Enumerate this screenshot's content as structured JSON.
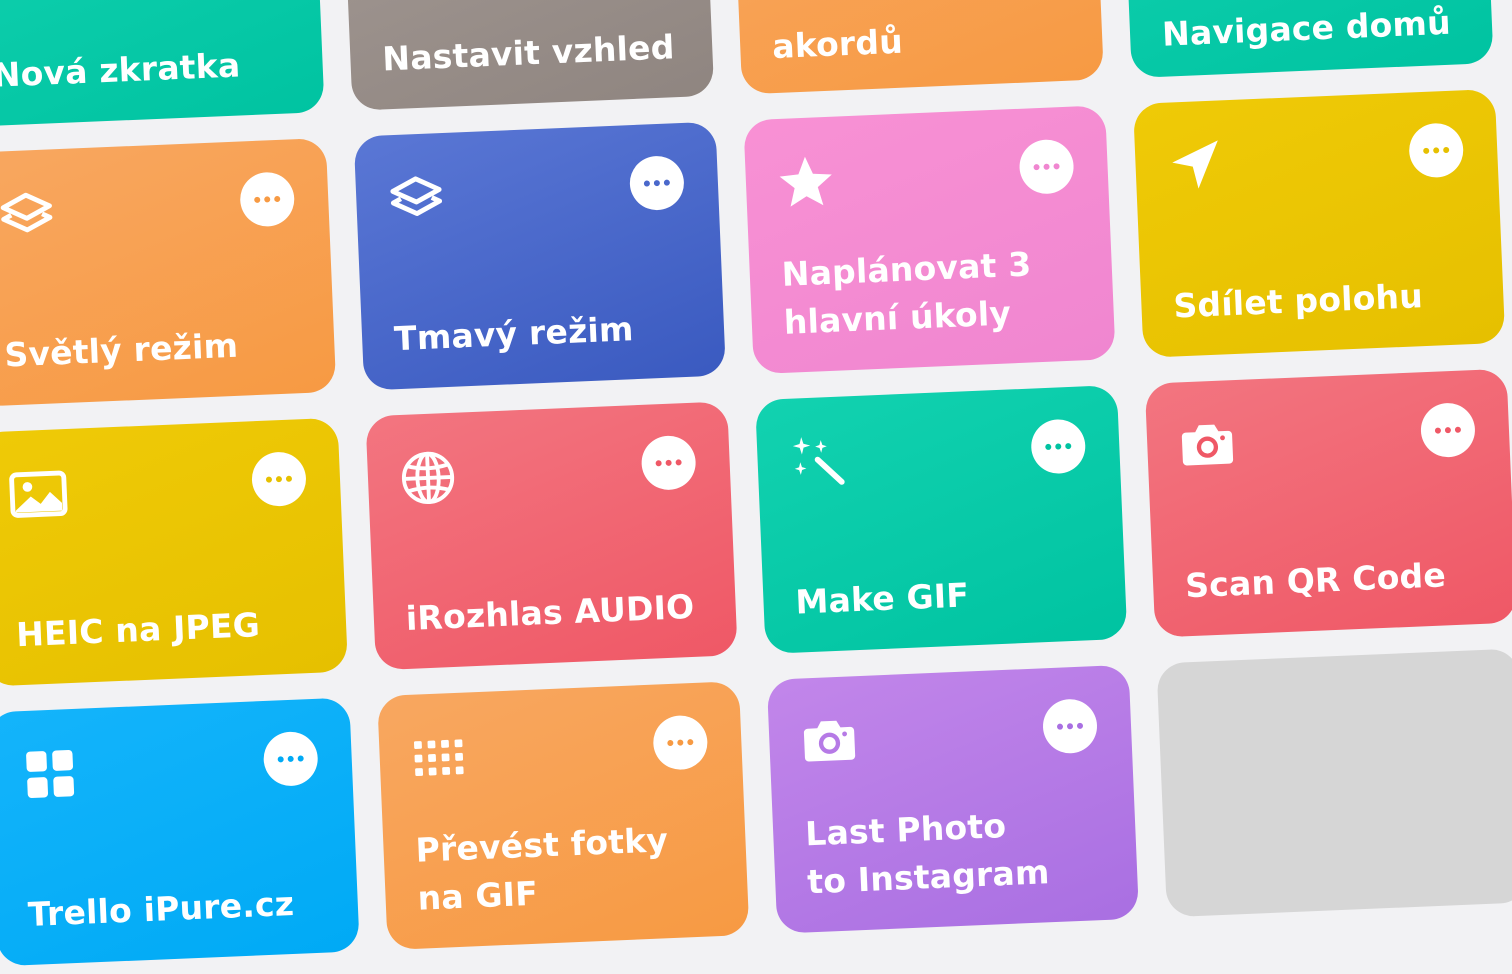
{
  "colors": {
    "green": "#06CBA8",
    "gray": "#998F8A",
    "orange": "#F7A04F",
    "blue": "#4A68CB",
    "pink": "#F48BD2",
    "yellow": "#EAC503",
    "red": "#F0636F",
    "cyan": "#0AAFF8",
    "purple": "#B67AE6",
    "empty": "#D6D6D6"
  },
  "shortcuts": {
    "top": [
      {
        "label": "Nová zkratka"
      },
      {
        "label": "Nastavit vzhled"
      },
      {
        "label": "akordů"
      },
      {
        "label": "Navigace domů"
      }
    ],
    "row2": [
      {
        "label": "Světlý režim",
        "icon": "layers-icon"
      },
      {
        "label": "Tmavý režim",
        "icon": "layers-icon"
      },
      {
        "label": "Naplánovat 3\nhlavní úkoly",
        "icon": "star-icon"
      },
      {
        "label": "Sdílet polohu",
        "icon": "location-arrow-icon"
      }
    ],
    "row3": [
      {
        "label": "HEIC na JPEG",
        "icon": "photo-icon"
      },
      {
        "label": "iRozhlas AUDIO",
        "icon": "globe-icon"
      },
      {
        "label": "Make GIF",
        "icon": "magic-wand-icon"
      },
      {
        "label": "Scan QR Code",
        "icon": "camera-icon"
      }
    ],
    "row4": [
      {
        "label": "Trello iPure.cz",
        "icon": "grid-icon"
      },
      {
        "label": "Převést fotky\nna GIF",
        "icon": "keypad-icon"
      },
      {
        "label": "Last Photo\nto Instagram",
        "icon": "camera-icon"
      }
    ]
  }
}
